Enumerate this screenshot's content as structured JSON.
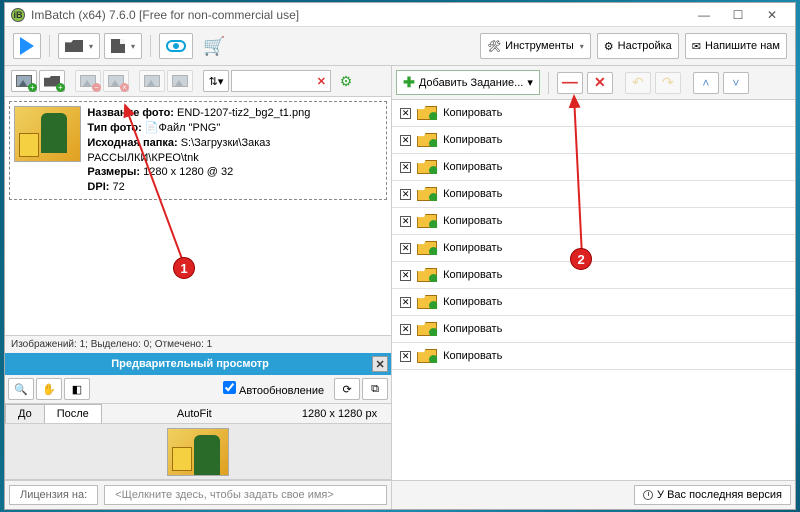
{
  "window": {
    "title": "ImBatch (x64) 7.6.0 [Free for non-commercial use]"
  },
  "toolbar": {
    "tools_label": "Инструменты",
    "settings_label": "Настройка",
    "mail_label": "Напишите нам"
  },
  "file": {
    "name_label": "Название фото:",
    "name_value": "END-1207-tiz2_bg2_t1.png",
    "type_label": "Тип фото:",
    "type_value": "Файл \"PNG\"",
    "src_label": "Исходная папка:",
    "src_value": "S:\\Загрузки\\Заказ РАССЫЛКИ\\КРЕО\\tnk",
    "size_label": "Размеры:",
    "size_value": "1280 x 1280 @ 32",
    "dpi_label": "DPI:",
    "dpi_value": "72"
  },
  "status_left": "Изображений: 1; Выделено: 0; Отмечено: 1",
  "preview": {
    "title": "Предварительный просмотр",
    "auto": "Автообновление",
    "tab_before": "До",
    "tab_after": "После",
    "fit": "AutoFit",
    "dim": "1280 x 1280 px"
  },
  "bottom": {
    "license_label": "Лицензия на:",
    "license_hint": "<Щелкните здесь, чтобы задать свое имя>"
  },
  "right": {
    "add_label": "Добавить Задание...",
    "task_label": "Копировать",
    "tasks_count": 10,
    "version": "У Вас последняя версия"
  },
  "markers": {
    "m1": "1",
    "m2": "2"
  }
}
